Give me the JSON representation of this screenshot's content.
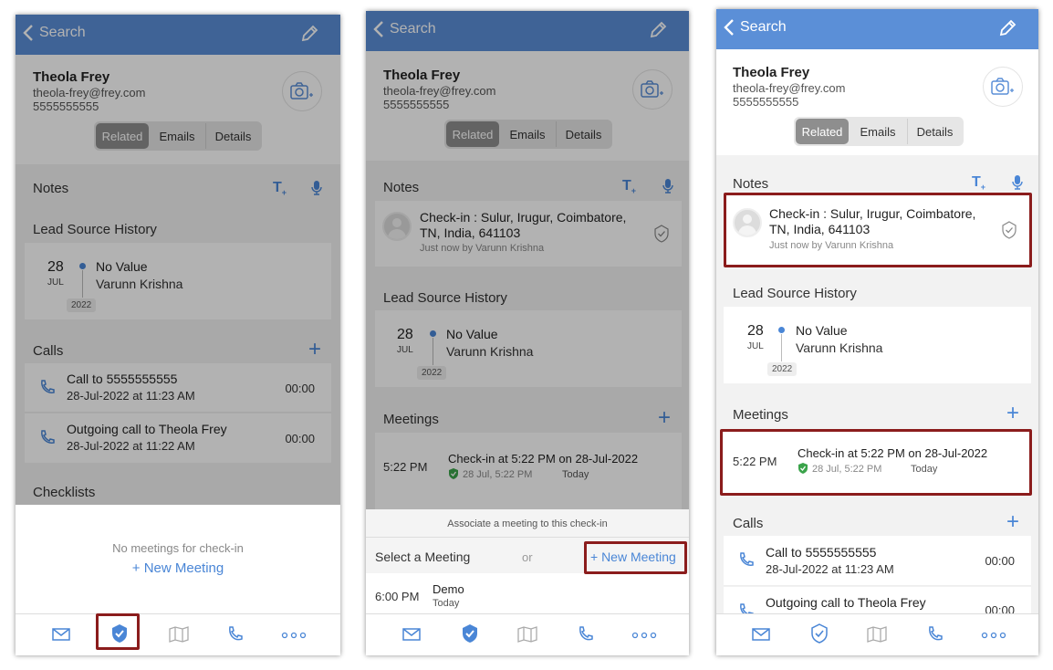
{
  "nav": {
    "back_label": "Search"
  },
  "contact": {
    "name": "Theola Frey",
    "email": "theola-frey@frey.com",
    "phone": "5555555555"
  },
  "tabs": {
    "related": "Related",
    "emails": "Emails",
    "details": "Details"
  },
  "sections": {
    "notes": "Notes",
    "lead_source_history": "Lead Source History",
    "calls": "Calls",
    "checklists": "Checklists",
    "meetings": "Meetings"
  },
  "lead_source": {
    "day": "28",
    "month": "JUL",
    "year": "2022",
    "value": "No Value",
    "owner": "Varunn Krishna"
  },
  "calls": [
    {
      "title": "Call to 5555555555",
      "date": "28-Jul-2022 at 11:23 AM",
      "duration": "00:00"
    },
    {
      "title": "Outgoing call to Theola Frey",
      "date": "28-Jul-2022 at 11:22 AM",
      "duration": "00:00"
    }
  ],
  "note": {
    "text": "Check-in : Sulur, Irugur, Coimbatore, TN, India, 641103",
    "meta": "Just now by Varunn Krishna"
  },
  "meeting": {
    "time": "5:22 PM",
    "title": "Check-in at 5:22 PM on 28-Jul-2022",
    "checkin": "28 Jul, 5:22 PM",
    "when": "Today"
  },
  "screen1_sheet": {
    "empty_text": "No meetings for check-in",
    "new_meeting": "+ New Meeting"
  },
  "screen2_sheet": {
    "header": "Associate a meeting to this check-in",
    "select_label": "Select a Meeting",
    "or": "or",
    "new_meeting": "+ New Meeting",
    "item_time": "6:00 PM",
    "item_title": "Demo",
    "item_day": "Today"
  },
  "colors": {
    "nav": "#5b8fd7",
    "accent": "#4a86d6",
    "highlight": "#8b1c1c",
    "checkin_green": "#3aa34a"
  }
}
